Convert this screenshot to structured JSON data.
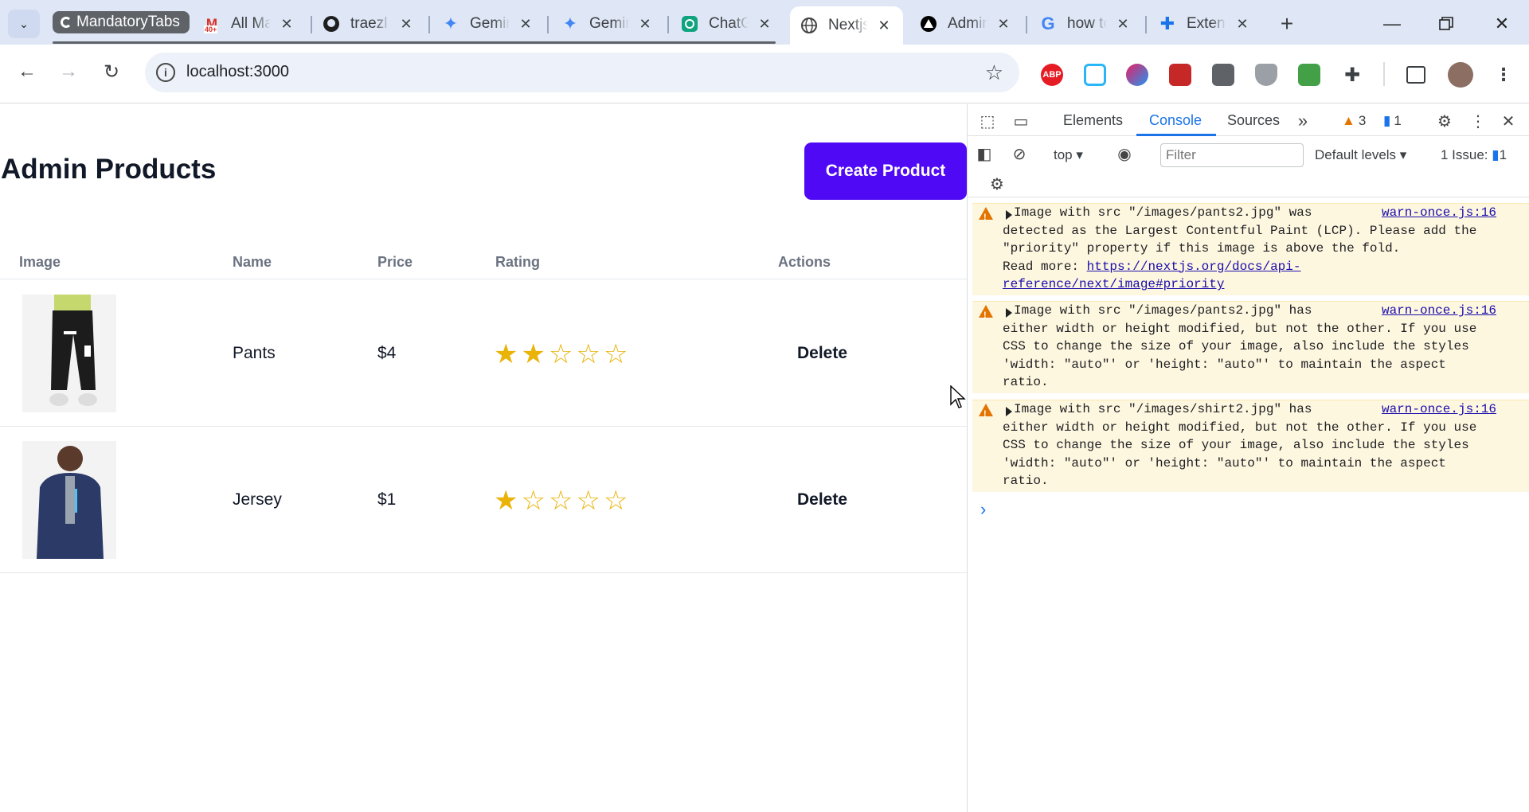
{
  "browser": {
    "tab_group_label": "MandatoryTabs",
    "tabs": [
      {
        "title": "All Mail",
        "icon": "gmail-icon",
        "badge": "40+"
      },
      {
        "title": "traezl",
        "icon": "github-icon"
      },
      {
        "title": "Gemini",
        "icon": "gemini-icon"
      },
      {
        "title": "Gemini",
        "icon": "gemini-icon"
      },
      {
        "title": "ChatGPT",
        "icon": "chatgpt-icon"
      },
      {
        "title": "Nextjs",
        "icon": "globe-icon",
        "active": true
      },
      {
        "title": "Admin",
        "icon": "vercel-icon"
      },
      {
        "title": "how to",
        "icon": "google-icon"
      },
      {
        "title": "Extensions",
        "icon": "puzzle-icon"
      }
    ],
    "url": "localhost:3000",
    "abp_label": "ABP"
  },
  "page": {
    "title": "Admin Products",
    "create_button": "Create Product",
    "columns": {
      "image": "Image",
      "name": "Name",
      "price": "Price",
      "rating": "Rating",
      "actions": "Actions"
    },
    "products": [
      {
        "name": "Pants",
        "price": "$4",
        "rating": 2,
        "max_rating": 5,
        "action": "Delete"
      },
      {
        "name": "Jersey",
        "price": "$1",
        "rating": 1,
        "max_rating": 5,
        "action": "Delete"
      }
    ]
  },
  "devtools": {
    "tabs": [
      "Elements",
      "Console",
      "Sources"
    ],
    "active_tab": "Console",
    "warning_count": "3",
    "message_count": "1",
    "context": "top",
    "filter_placeholder": "Filter",
    "levels": "Default levels",
    "issues_label": "1 Issue:",
    "issues_count": "1",
    "messages": [
      {
        "source": "warn-once.js:16",
        "text": "Image with src \"/images/pants2.jpg\" was\ndetected as the Largest Contentful Paint (LCP). Please add the\n\"priority\" property if this image is above the fold.\nRead more: ",
        "link": "https://nextjs.org/docs/api-reference/next/image#priority"
      },
      {
        "source": "warn-once.js:16",
        "text": "Image with src \"/images/pants2.jpg\" has\neither width or height modified, but not the other. If you use\nCSS to change the size of your image, also include the styles\n'width: \"auto\"' or 'height: \"auto\"' to maintain the aspect\nratio."
      },
      {
        "source": "warn-once.js:16",
        "text": "Image with src \"/images/shirt2.jpg\" has\neither width or height modified, but not the other. If you use\nCSS to change the size of your image, also include the styles\n'width: \"auto\"' or 'height: \"auto\"' to maintain the aspect\nratio."
      }
    ]
  },
  "colors": {
    "accent": "#4f09f5",
    "star": "#eab308",
    "warning_bg": "#fef7e0",
    "devtools_active": "#1a73e8"
  }
}
